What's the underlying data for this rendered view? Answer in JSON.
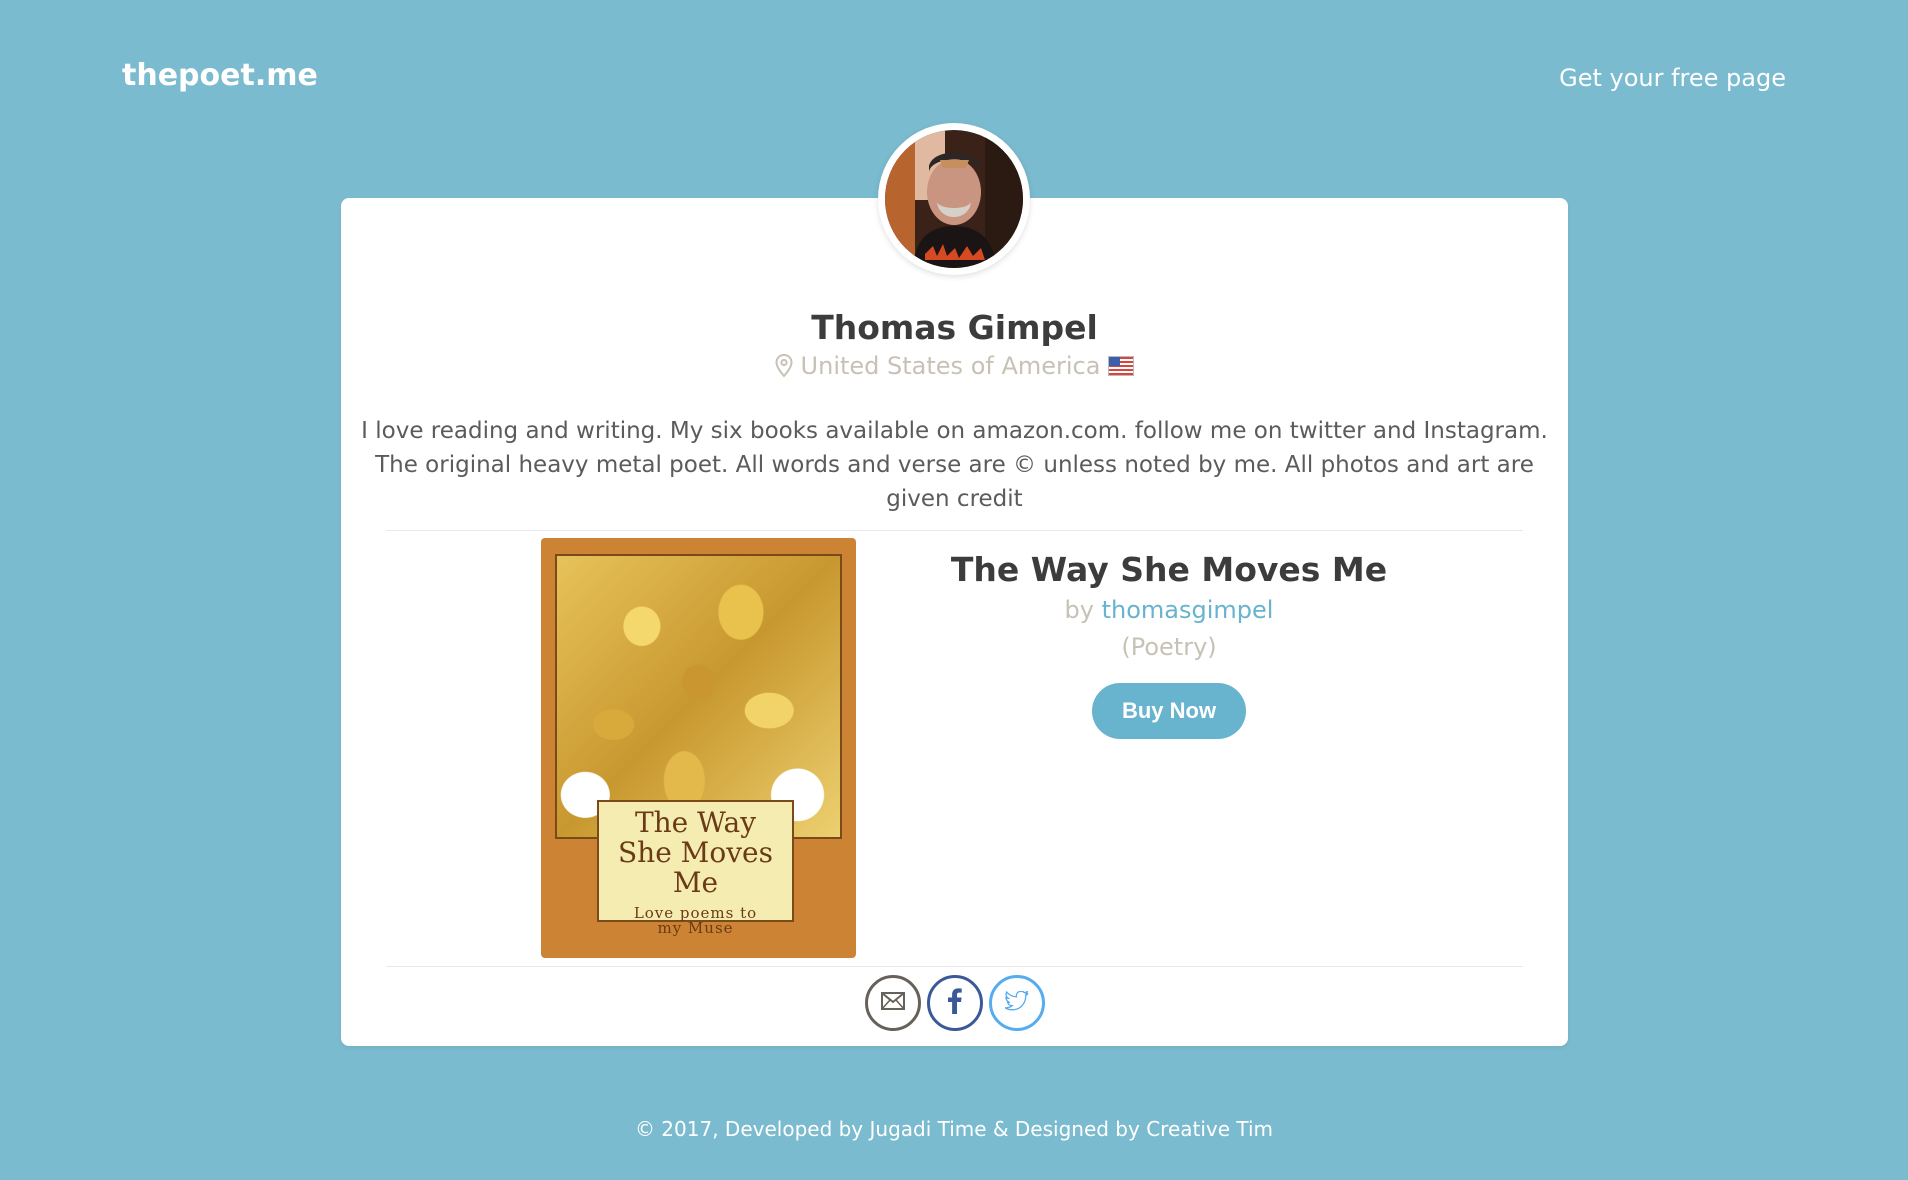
{
  "nav": {
    "brand": "thepoet.me",
    "cta": "Get your free page"
  },
  "profile": {
    "name": "Thomas Gimpel",
    "location": "United States of America",
    "bio": "I love reading and writing. My six books available on amazon.com. follow me on twitter and Instagram. The original heavy metal poet. All words and verse are © unless noted by me. All photos and art are given credit"
  },
  "book": {
    "title": "The Way She Moves Me",
    "by_prefix": "by",
    "author": "thomasgimpel",
    "genre": "(Poetry)",
    "buy_label": "Buy Now",
    "cover_title": "The Way She Moves Me",
    "cover_subtitle": "Love poems to my Muse"
  },
  "social": {
    "icons": [
      "mail-icon",
      "facebook-icon",
      "twitter-icon"
    ]
  },
  "footer": {
    "text": "© 2017, Developed by Jugadi Time & Designed by Creative Tim"
  },
  "colors": {
    "background": "#7bbbcf",
    "accent": "#68b3cd",
    "facebook": "#3b5998",
    "twitter": "#55acee"
  }
}
